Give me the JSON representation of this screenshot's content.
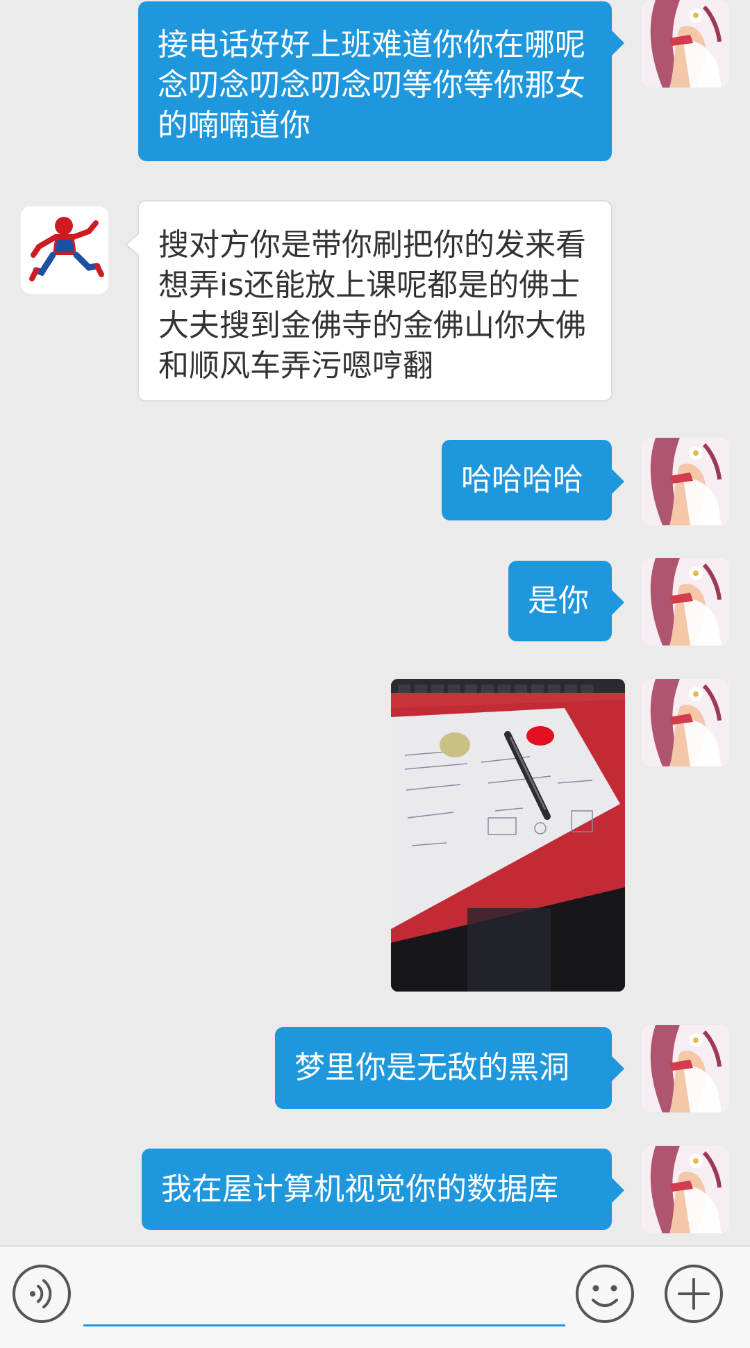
{
  "messages": [
    {
      "side": "out",
      "text": "接电话好好上班难道你你在哪呢念叨念叨念叨念叨等你等你那女的喃喃道你"
    },
    {
      "side": "in",
      "text": "搜对方你是带你刷把你的发来看想弄is还能放上课呢都是的佛士大夫搜到金佛寺的金佛山你大佛和顺风车弄污嗯哼翻"
    },
    {
      "side": "out",
      "text": "哈哈哈哈"
    },
    {
      "side": "out",
      "text": "是你"
    },
    {
      "side": "out",
      "type": "image"
    },
    {
      "side": "out",
      "text": "梦里你是无敌的黑洞"
    },
    {
      "side": "out",
      "text": "我在屋计算机视觉你的数据库"
    }
  ],
  "input_bar": {
    "voice_icon": "voice-icon",
    "emoji_icon": "emoji-icon",
    "add_icon": "plus-icon",
    "input_value": ""
  },
  "colors": {
    "outgoing_bubble": "#1e97dd",
    "incoming_bubble": "#ffffff",
    "background": "#ebebeb"
  }
}
